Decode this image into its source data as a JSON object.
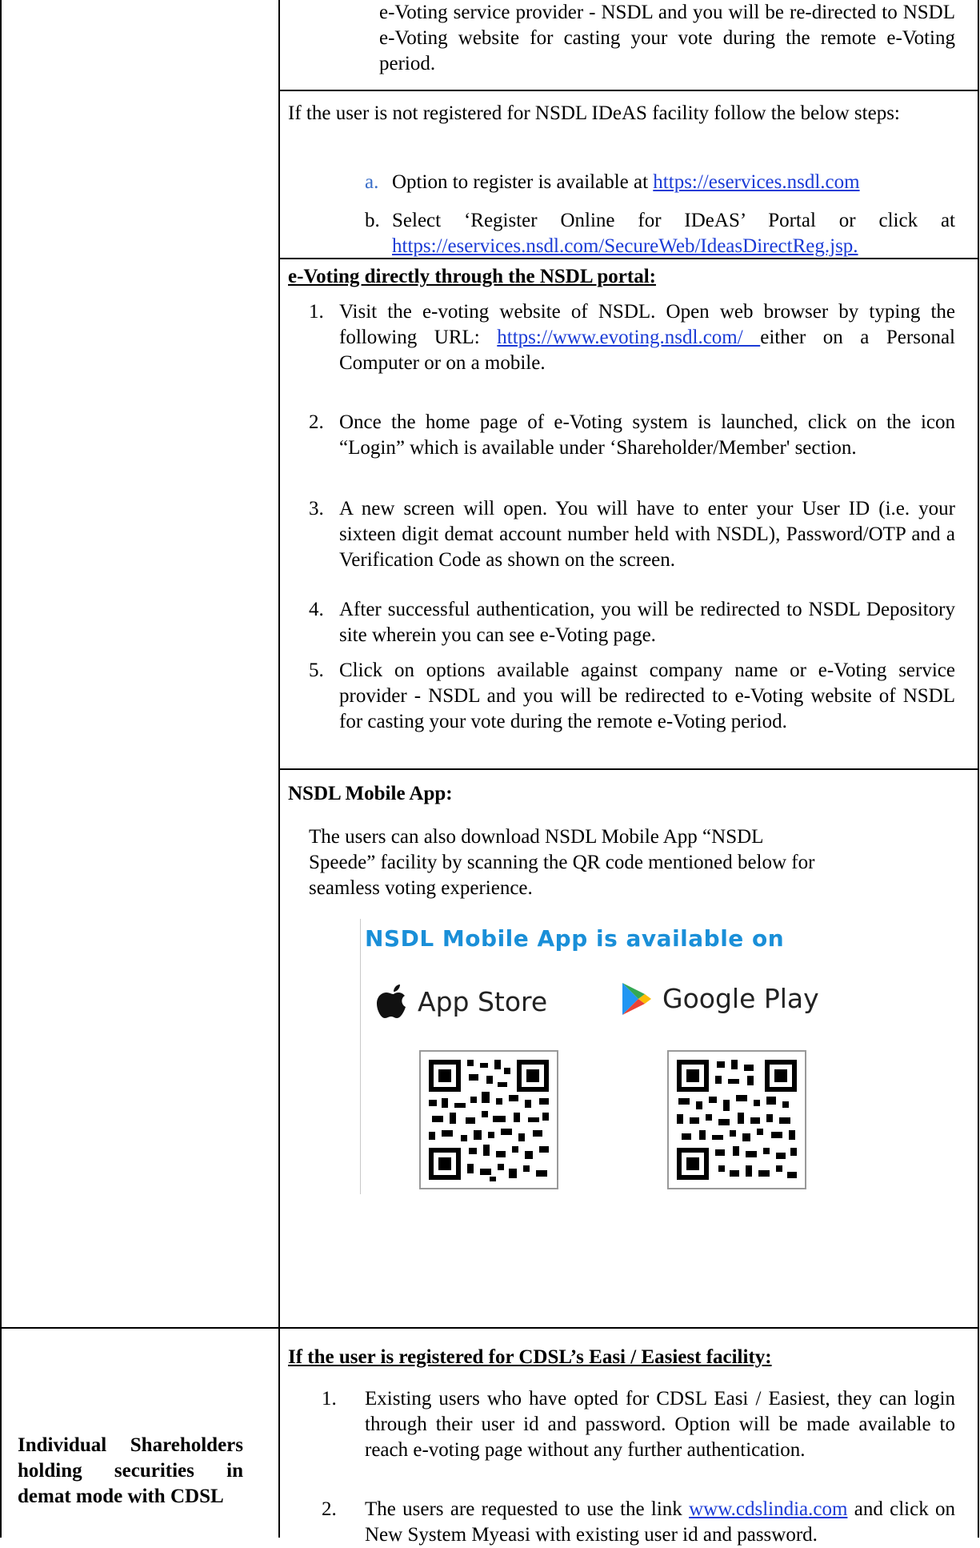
{
  "top_cell": {
    "cont_text": "e-Voting service provider - NSDL and you will be re-directed to NSDL e-Voting website for casting your vote during the remote e-Voting period."
  },
  "ideas_cell": {
    "intro": "If the user is not registered for NSDL IDeAS facility follow the below steps:",
    "item_a_marker": "a.",
    "item_a_text": "Option to register is available at ",
    "item_a_link": "https://eservices.nsdl.com",
    "item_b_marker": "b.",
    "item_b_text": "Select ‘Register Online for IDeAS’ Portal or click at ",
    "item_b_link": "https://eservices.nsdl.com/SecureWeb/IdeasDirectReg.jsp."
  },
  "portal_cell": {
    "heading": "e-Voting directly through the NSDL portal:",
    "steps": [
      {
        "n": "1.",
        "pre": "Visit the e-voting website of NSDL. Open web browser by typing the following URL: ",
        "link": "https://www.evoting.nsdl.com/ ",
        "post": "either on a Personal Computer or on a mobile."
      },
      {
        "n": "2.",
        "text": "Once the home page of e-Voting system is launched, click on the icon “Login” which is available under ‘Shareholder/Member' section."
      },
      {
        "n": "3.",
        "text": "A new screen will open. You will have to enter your User ID (i.e. your sixteen digit demat account number held with NSDL), Password/OTP and a Verification Code as shown on the screen."
      },
      {
        "n": "4.",
        "text": "After successful authentication, you will be redirected to NSDL Depository site wherein you can see e-Voting page."
      },
      {
        "n": "5.",
        "text": "Click on options available against company name or e-Voting service provider - NSDL and you will be redirected to e-Voting website of NSDL for casting your vote during the remote e-Voting period."
      }
    ]
  },
  "mobile_cell": {
    "heading": "NSDL Mobile App:",
    "text": "The users can also download NSDL Mobile App “NSDL Speede” facility by scanning the QR code mentioned below for seamless voting experience.",
    "banner_title": "NSDL Mobile App is available on",
    "app_store": "App Store",
    "google_play": "Google Play"
  },
  "cdsl_cell": {
    "left_label": "Individual Shareholders holding securities in demat mode with CDSL",
    "heading": "If the user is registered for CDSL’s Easi / Easiest facility:",
    "step1_n": "1.",
    "step1": "Existing users who have opted for CDSL Easi / Easiest, they can login through their user id and password. Option will be made available to reach e-voting page without any further authentication.",
    "step2_n": "2.",
    "step2_pre": "The users are requested to use the link ",
    "step2_link": "www.cdslindia.com",
    "step2_post": "  and click on New System Myeasi with existing user id and password."
  },
  "colors": {
    "link": "#1a3bd6",
    "brand": "#1a8fd8",
    "marker_blue": "#3b6fc9"
  }
}
